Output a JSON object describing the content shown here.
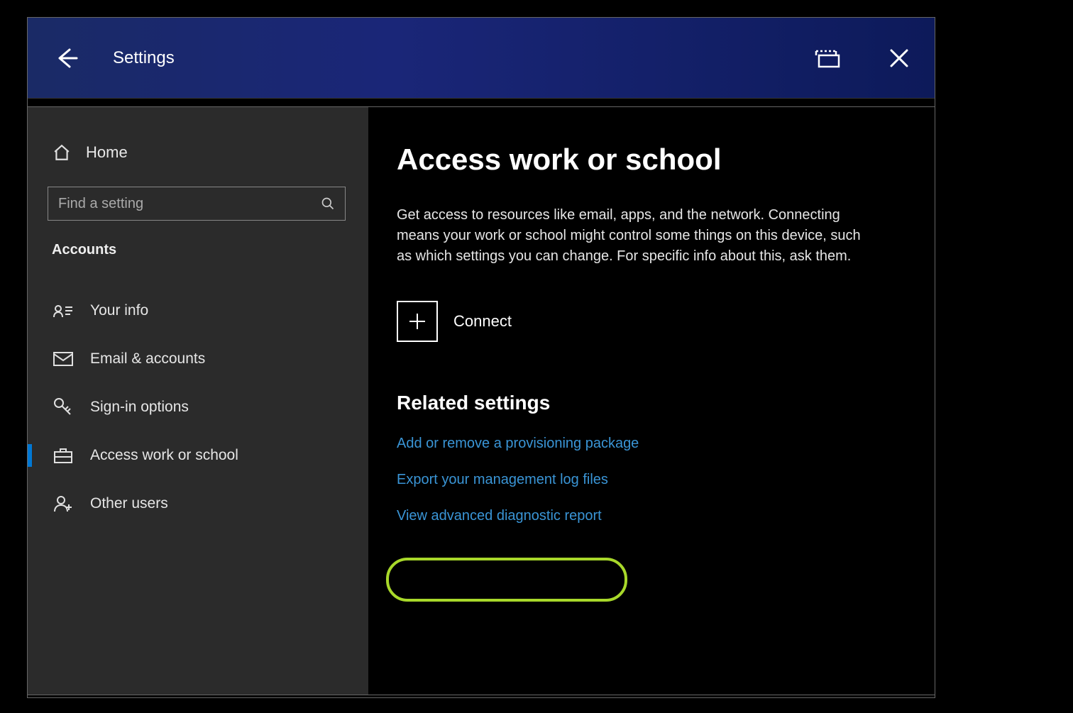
{
  "titlebar": {
    "title": "Settings"
  },
  "sidebar": {
    "home_label": "Home",
    "search_placeholder": "Find a setting",
    "category": "Accounts",
    "items": [
      {
        "label": "Your info"
      },
      {
        "label": "Email & accounts"
      },
      {
        "label": "Sign-in options"
      },
      {
        "label": "Access work or school"
      },
      {
        "label": "Other users"
      }
    ]
  },
  "main": {
    "title": "Access work or school",
    "description": "Get access to resources like email, apps, and the network. Connecting means your work or school might control some things on this device, such as which settings you can change. For specific info about this, ask them.",
    "connect_label": "Connect",
    "related_heading": "Related settings",
    "links": [
      "Add or remove a provisioning package",
      "Export your management log files",
      "View advanced diagnostic report"
    ]
  },
  "colors": {
    "accent": "#0078d4",
    "link": "#3a95d6",
    "highlight": "#a8d82a",
    "titlebar_bg": "#1a2678"
  }
}
